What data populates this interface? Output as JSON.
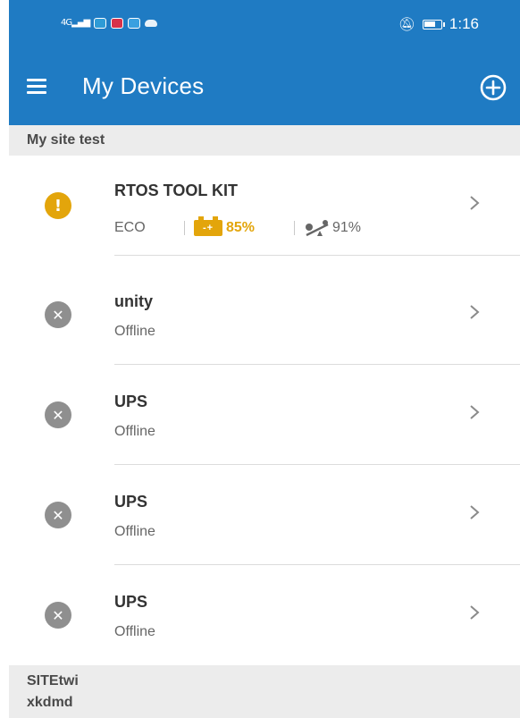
{
  "statusbar": {
    "network": "4G",
    "time": "1:16",
    "icons": [
      "signal-icon",
      "app-notification-icon",
      "app-notification-icon",
      "app-notification-icon",
      "cloud-icon",
      "bell-off-icon",
      "battery-icon"
    ]
  },
  "appbar": {
    "title": "My Devices",
    "menu_icon": "hamburger-menu-icon",
    "add_icon": "add-circle-icon"
  },
  "sections": [
    {
      "title": "My site test",
      "devices": [
        {
          "name": "RTOS TOOL KIT",
          "status": "warning",
          "status_icon": "exclamation-icon",
          "mode": "ECO",
          "battery": "85%",
          "load": "91%"
        },
        {
          "name": "unity",
          "status": "offline",
          "status_icon": "x-icon",
          "subtitle": "Offline"
        },
        {
          "name": "UPS",
          "status": "offline",
          "status_icon": "x-icon",
          "subtitle": "Offline"
        },
        {
          "name": "UPS",
          "status": "offline",
          "status_icon": "x-icon",
          "subtitle": "Offline"
        },
        {
          "name": "UPS",
          "status": "offline",
          "status_icon": "x-icon",
          "subtitle": "Offline"
        }
      ]
    },
    {
      "title": "SITEtwi",
      "subtitle": "xkdmd"
    }
  ],
  "colors": {
    "primary": "#1f7bc3",
    "warning": "#e3a50b",
    "offline": "#8f8f8f",
    "section_bg": "#ececec"
  }
}
